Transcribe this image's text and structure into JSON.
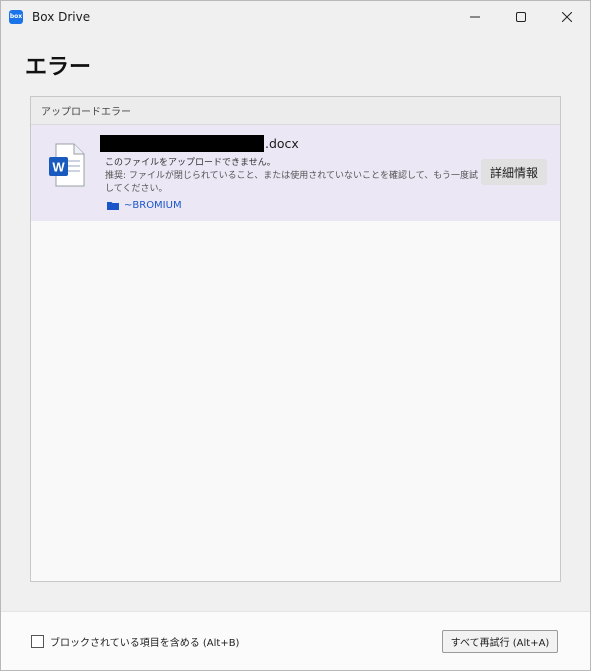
{
  "window": {
    "app_name": "Box Drive",
    "logo_text": "box"
  },
  "page": {
    "title": "エラー"
  },
  "panel": {
    "header": "アップロードエラー",
    "errors": [
      {
        "file_name_suffix": ".docx",
        "message": "このファイルをアップロードできません。",
        "hint": "推奨: ファイルが閉じられていること、または使用されていないことを確認して、もう一度試してください。",
        "folder": "~BROMIUM",
        "details_label": "詳細情報",
        "file_icon_letter": "W"
      }
    ]
  },
  "footer": {
    "checkbox_label": "ブロックされている項目を含める (Alt+B)",
    "retry_label": "すべて再試行 (Alt+A)"
  },
  "colors": {
    "accent": "#1a73e8",
    "row_highlight": "#ebe7f4",
    "word_blue": "#185abd",
    "folder_link": "#1a56c9"
  }
}
